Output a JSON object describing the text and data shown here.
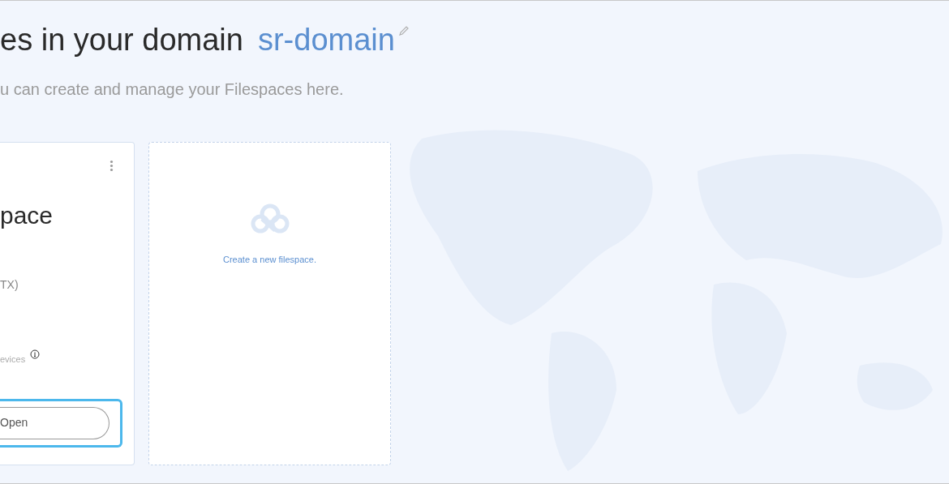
{
  "header": {
    "title": "es in your domain",
    "domain": "sr-domain",
    "subtitle": "u can create and manage your Filespaces here."
  },
  "filespaces": [
    {
      "name": "pace",
      "location": "TX)",
      "devices": "evices",
      "open_button": "Open",
      "focused": true
    }
  ],
  "new_filespace": {
    "label": "Create a new filespace."
  }
}
